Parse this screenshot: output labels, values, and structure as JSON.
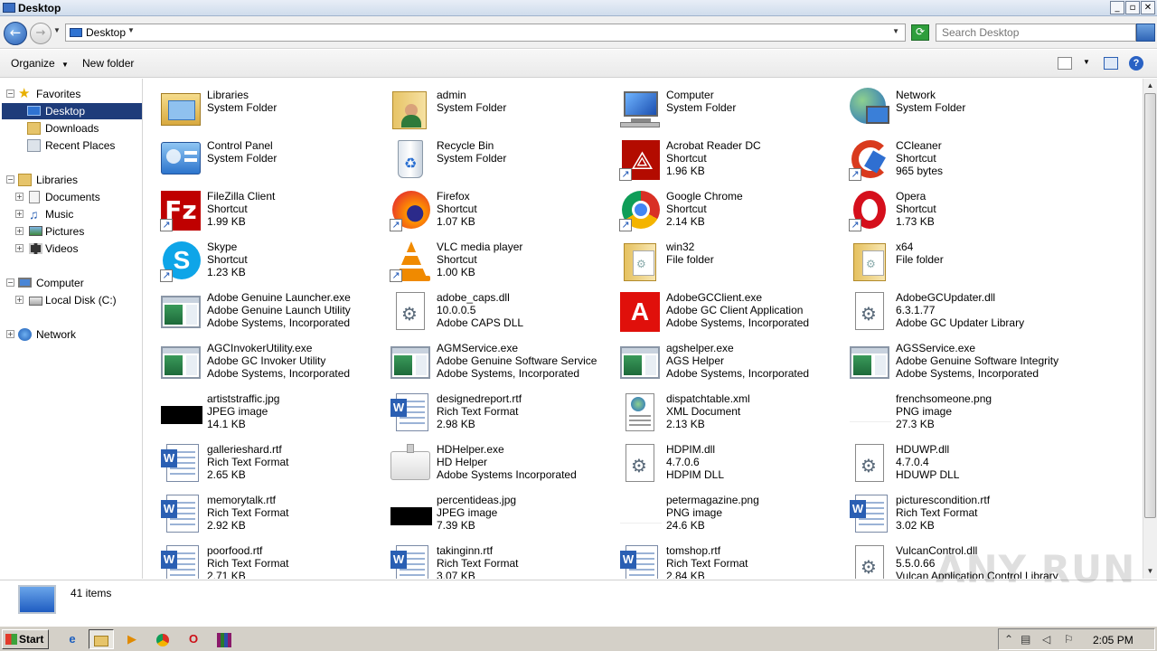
{
  "window": {
    "title": "Desktop",
    "minimize": "_",
    "restore": "▫",
    "close": "✕"
  },
  "address": {
    "location": "Desktop",
    "search_placeholder": "Search Desktop"
  },
  "toolbar": {
    "organize": "Organize",
    "new_folder": "New folder",
    "help": "?"
  },
  "nav": {
    "favorites": "Favorites",
    "desktop": "Desktop",
    "downloads": "Downloads",
    "recent": "Recent Places",
    "libraries": "Libraries",
    "documents": "Documents",
    "music": "Music",
    "pictures": "Pictures",
    "videos": "Videos",
    "computer": "Computer",
    "localdisk": "Local Disk (C:)",
    "network": "Network"
  },
  "items": [
    {
      "name": "Libraries",
      "l2": "System Folder",
      "l3": "",
      "icon": "libraries-icon"
    },
    {
      "name": "admin",
      "l2": "System Folder",
      "l3": "",
      "icon": "user-folder-icon"
    },
    {
      "name": "Computer",
      "l2": "System Folder",
      "l3": "",
      "icon": "computer-icon"
    },
    {
      "name": "Network",
      "l2": "System Folder",
      "l3": "",
      "icon": "network-icon"
    },
    {
      "name": "Control Panel",
      "l2": "System Folder",
      "l3": "",
      "icon": "control-panel-icon"
    },
    {
      "name": "Recycle Bin",
      "l2": "System Folder",
      "l3": "",
      "icon": "recycle-bin-icon"
    },
    {
      "name": "Acrobat Reader DC",
      "l2": "Shortcut",
      "l3": "1.96 KB",
      "icon": "acrobat-icon"
    },
    {
      "name": "CCleaner",
      "l2": "Shortcut",
      "l3": "965 bytes",
      "icon": "ccleaner-icon"
    },
    {
      "name": "FileZilla Client",
      "l2": "Shortcut",
      "l3": "1.99 KB",
      "icon": "filezilla-icon"
    },
    {
      "name": "Firefox",
      "l2": "Shortcut",
      "l3": "1.07 KB",
      "icon": "firefox-icon"
    },
    {
      "name": "Google Chrome",
      "l2": "Shortcut",
      "l3": "2.14 KB",
      "icon": "chrome-icon"
    },
    {
      "name": "Opera",
      "l2": "Shortcut",
      "l3": "1.73 KB",
      "icon": "opera-icon"
    },
    {
      "name": "Skype",
      "l2": "Shortcut",
      "l3": "1.23 KB",
      "icon": "skype-icon"
    },
    {
      "name": "VLC media player",
      "l2": "Shortcut",
      "l3": "1.00 KB",
      "icon": "vlc-icon"
    },
    {
      "name": "win32",
      "l2": "File folder",
      "l3": "",
      "icon": "folder-icon"
    },
    {
      "name": "x64",
      "l2": "File folder",
      "l3": "",
      "icon": "folder-icon"
    },
    {
      "name": "Adobe Genuine Launcher.exe",
      "l2": "Adobe Genuine Launch Utility",
      "l3": "Adobe Systems, Incorporated",
      "icon": "exe-icon"
    },
    {
      "name": "adobe_caps.dll",
      "l2": "10.0.0.5",
      "l3": "Adobe CAPS DLL",
      "icon": "dll-icon"
    },
    {
      "name": "AdobeGCClient.exe",
      "l2": "Adobe GC Client Application",
      "l3": "Adobe Systems, Incorporated",
      "icon": "adobe-icon"
    },
    {
      "name": "AdobeGCUpdater.dll",
      "l2": "6.3.1.77",
      "l3": "Adobe GC Updater Library",
      "icon": "dll-icon"
    },
    {
      "name": "AGCInvokerUtility.exe",
      "l2": "Adobe GC Invoker Utility",
      "l3": "Adobe Systems, Incorporated",
      "icon": "exe-icon"
    },
    {
      "name": "AGMService.exe",
      "l2": "Adobe Genuine Software Service",
      "l3": "Adobe Systems, Incorporated",
      "icon": "exe-icon"
    },
    {
      "name": "agshelper.exe",
      "l2": "AGS Helper",
      "l3": "Adobe Systems, Incorporated",
      "icon": "exe-icon"
    },
    {
      "name": "AGSService.exe",
      "l2": "Adobe Genuine Software Integrity S...",
      "l3": "Adobe Systems, Incorporated",
      "icon": "exe-icon"
    },
    {
      "name": "artiststraffic.jpg",
      "l2": "JPEG image",
      "l3": "14.1 KB",
      "icon": "jpg-thumb-icon"
    },
    {
      "name": "designedreport.rtf",
      "l2": "Rich Text Format",
      "l3": "2.98 KB",
      "icon": "rtf-icon"
    },
    {
      "name": "dispatchtable.xml",
      "l2": "XML Document",
      "l3": "2.13 KB",
      "icon": "xml-icon"
    },
    {
      "name": "frenchsomeone.png",
      "l2": "PNG image",
      "l3": "27.3 KB",
      "icon": "png-thumb-icon"
    },
    {
      "name": "gallerieshard.rtf",
      "l2": "Rich Text Format",
      "l3": "2.65 KB",
      "icon": "rtf-icon"
    },
    {
      "name": "HDHelper.exe",
      "l2": "HD Helper",
      "l3": "Adobe Systems Incorporated",
      "icon": "hdhelper-icon"
    },
    {
      "name": "HDPIM.dll",
      "l2": "4.7.0.6",
      "l3": "HDPIM DLL",
      "icon": "dll-icon"
    },
    {
      "name": "HDUWP.dll",
      "l2": "4.7.0.4",
      "l3": "HDUWP DLL",
      "icon": "dll-icon"
    },
    {
      "name": "memorytalk.rtf",
      "l2": "Rich Text Format",
      "l3": "2.92 KB",
      "icon": "rtf-icon"
    },
    {
      "name": "percentideas.jpg",
      "l2": "JPEG image",
      "l3": "7.39 KB",
      "icon": "jpg-thumb-icon"
    },
    {
      "name": "petermagazine.png",
      "l2": "PNG image",
      "l3": "24.6 KB",
      "icon": "png-thumb-icon"
    },
    {
      "name": "picturescondition.rtf",
      "l2": "Rich Text Format",
      "l3": "3.02 KB",
      "icon": "rtf-icon"
    },
    {
      "name": "poorfood.rtf",
      "l2": "Rich Text Format",
      "l3": "2.71 KB",
      "icon": "rtf-icon"
    },
    {
      "name": "takinginn.rtf",
      "l2": "Rich Text Format",
      "l3": "3.07 KB",
      "icon": "rtf-icon"
    },
    {
      "name": "tomshop.rtf",
      "l2": "Rich Text Format",
      "l3": "2.84 KB",
      "icon": "rtf-icon"
    },
    {
      "name": "VulcanControl.dll",
      "l2": "5.5.0.66",
      "l3": "Vulcan Application Control Library",
      "icon": "dll-icon"
    }
  ],
  "status": {
    "count": "41 items"
  },
  "taskbar": {
    "start": "Start",
    "time": "2:05 PM"
  },
  "watermark": "ANY RUN"
}
